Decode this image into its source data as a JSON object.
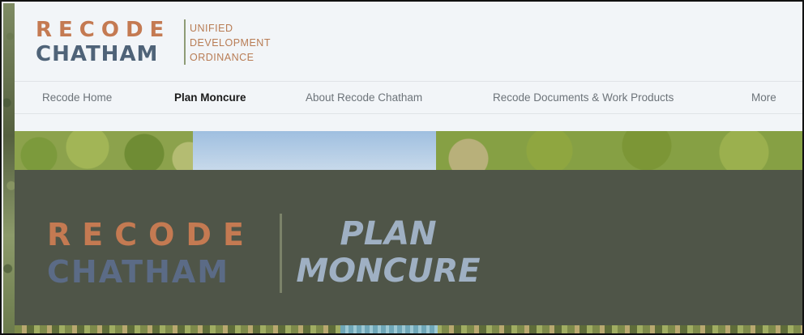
{
  "header": {
    "logo": {
      "line1": "RECODE",
      "line2": "CHATHAM",
      "sub": [
        "UNIFIED",
        "DEVELOPMENT",
        "ORDINANCE"
      ]
    },
    "nav": [
      {
        "label": "Recode Home",
        "active": false
      },
      {
        "label": "Plan Moncure",
        "active": true
      },
      {
        "label": "About Recode Chatham",
        "active": false
      },
      {
        "label": "Recode Documents & Work Products",
        "active": false
      },
      {
        "label": "More",
        "active": false
      }
    ]
  },
  "hero": {
    "banner": {
      "line1": "RECODE",
      "line2": "CHATHAM",
      "title_line1": "PLAN",
      "title_line2": "MONCURE"
    }
  },
  "colors": {
    "brand_orange": "#c47a52",
    "brand_blue": "#4f6378",
    "banner_bg": "#4f5548",
    "title_blue": "#9fb0c3"
  }
}
